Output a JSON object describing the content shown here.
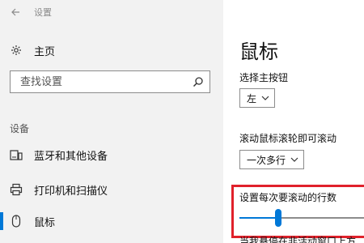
{
  "window": {
    "title": "设置"
  },
  "sidebar": {
    "home_label": "主页",
    "search_placeholder": "查找设置",
    "section_header": "设备",
    "items": [
      {
        "label": "蓝牙和其他设备",
        "icon": "bluetooth-devices-icon"
      },
      {
        "label": "打印机和扫描仪",
        "icon": "printer-icon"
      },
      {
        "label": "鼠标",
        "icon": "mouse-icon",
        "selected": true
      }
    ]
  },
  "main": {
    "title": "鼠标",
    "primary_button": {
      "label": "选择主按钮",
      "value": "左"
    },
    "scroll_mode": {
      "label": "滚动鼠标滚轮即可滚动",
      "value": "一次多行"
    },
    "lines_to_scroll": {
      "label": "设置每次要滚动的行数",
      "level_fraction": 0.3
    },
    "cut_off_text": "当我悬停在非活动窗口上方"
  },
  "colors": {
    "accent": "#0078d7",
    "highlight": "#e0212b",
    "sidebar_bg": "#f2f2f2"
  }
}
